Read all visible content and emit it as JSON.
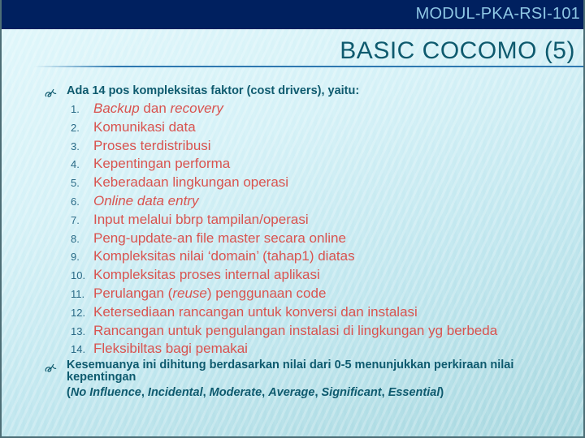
{
  "header": {
    "module_code": "MODUL-PKA-RSI-101",
    "title": "BASIC COCOMO (5)"
  },
  "colors": {
    "header_bar": "#00205f",
    "module_text": "#8ec6e4",
    "title_text": "#0e5a6e",
    "body_text": "#0e5a6e",
    "list_item_text": "#d9534f",
    "list_number": "#2a6a86",
    "title_rule": "#2e78b0"
  },
  "content": {
    "bullets": [
      {
        "icon": "curl-bullet-icon",
        "text": "Ada 14 pos kompleksitas faktor (cost drivers), yaitu:"
      },
      {
        "icon": "curl-bullet-icon",
        "text": "Kesemuanya ini dihitung berdasarkan nilai dari 0-5 menunjukkan perkiraan nilai kepentingan",
        "scale_open": "(",
        "scale": [
          "No Influence",
          "Incidental",
          "Moderate",
          "Average",
          "Significant",
          "Essential"
        ],
        "scale_sep": ", ",
        "scale_close": ")"
      }
    ],
    "cost_drivers": [
      {
        "num": "1.",
        "parts": [
          {
            "t": "Backup",
            "i": true
          },
          {
            "t": " dan ",
            "i": false
          },
          {
            "t": "recovery",
            "i": true
          }
        ]
      },
      {
        "num": "2.",
        "parts": [
          {
            "t": "Komunikasi data",
            "i": false
          }
        ]
      },
      {
        "num": "3.",
        "parts": [
          {
            "t": "Proses terdistribusi",
            "i": false
          }
        ]
      },
      {
        "num": "4.",
        "parts": [
          {
            "t": "Kepentingan performa",
            "i": false
          }
        ]
      },
      {
        "num": "5.",
        "parts": [
          {
            "t": "Keberadaan lingkungan operasi",
            "i": false
          }
        ]
      },
      {
        "num": "6.",
        "parts": [
          {
            "t": "Online data entry",
            "i": true
          }
        ]
      },
      {
        "num": "7.",
        "parts": [
          {
            "t": "Input melalui bbrp tampilan/operasi",
            "i": false
          }
        ]
      },
      {
        "num": "8.",
        "parts": [
          {
            "t": "Peng-update-an file master secara online",
            "i": false
          }
        ]
      },
      {
        "num": "9.",
        "parts": [
          {
            "t": "Kompleksitas nilai ‘domain’ (tahap1) diatas",
            "i": false
          }
        ]
      },
      {
        "num": "10.",
        "parts": [
          {
            "t": "Kompleksitas proses internal aplikasi",
            "i": false
          }
        ]
      },
      {
        "num": "11.",
        "parts": [
          {
            "t": "Perulangan (",
            "i": false
          },
          {
            "t": "reuse",
            "i": true
          },
          {
            "t": ") penggunaan code",
            "i": false
          }
        ]
      },
      {
        "num": "12.",
        "parts": [
          {
            "t": "Ketersediaan rancangan untuk konversi dan instalasi",
            "i": false
          }
        ]
      },
      {
        "num": "13.",
        "parts": [
          {
            "t": "Rancangan untuk pengulangan instalasi di lingkungan yg berbeda",
            "i": false
          }
        ]
      },
      {
        "num": "14.",
        "parts": [
          {
            "t": "Fleksibiltas bagi pemakai",
            "i": false
          }
        ]
      }
    ]
  }
}
